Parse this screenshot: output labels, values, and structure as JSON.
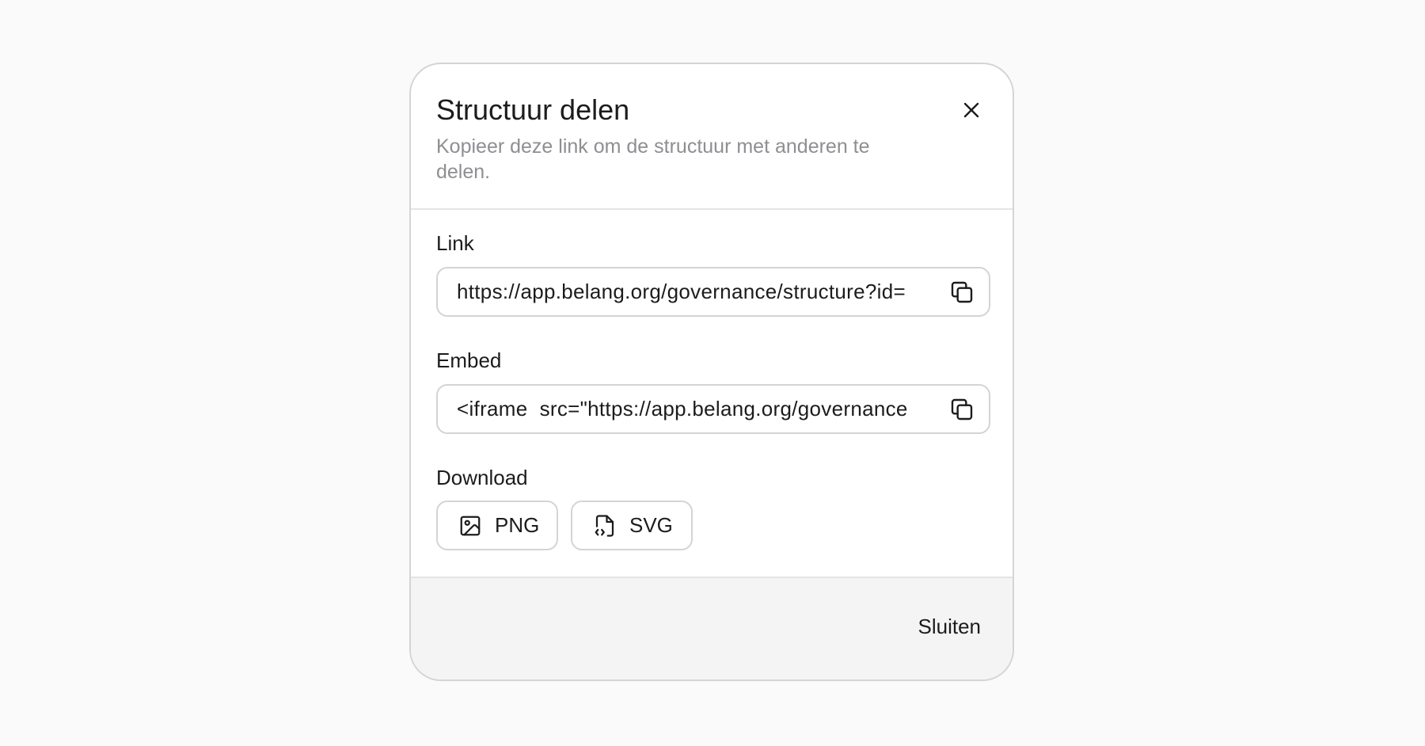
{
  "dialog": {
    "title": "Structuur delen",
    "subtitle": "Kopieer deze link om de structuur met anderen te delen.",
    "close_icon": "close-icon"
  },
  "link": {
    "label": "Link",
    "value": "https://app.belang.org/governance/structure?id=",
    "copy_icon": "copy-icon"
  },
  "embed": {
    "label": "Embed",
    "value": "<iframe  src=\"https://app.belang.org/governance",
    "copy_icon": "copy-icon"
  },
  "download": {
    "label": "Download",
    "buttons": [
      {
        "label": "PNG",
        "icon": "image-icon"
      },
      {
        "label": "SVG",
        "icon": "file-code-icon"
      }
    ]
  },
  "footer": {
    "close_label": "Sluiten"
  },
  "colors": {
    "background": "#fafafa",
    "border": "#d4d4d8",
    "text": "#1c1c1e",
    "muted": "#8e8e93",
    "footer_bg": "#f4f4f5"
  }
}
